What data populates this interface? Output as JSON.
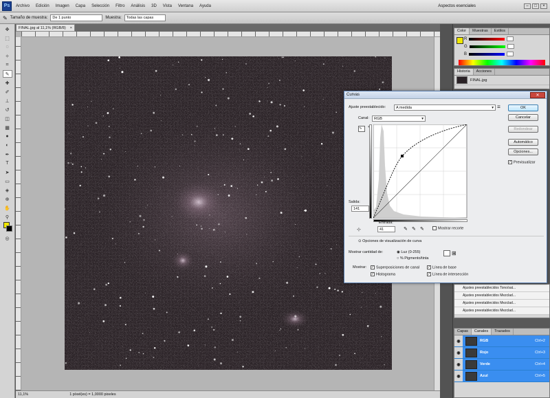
{
  "menubar": {
    "logo": "Ps",
    "items": [
      "Archivo",
      "Edición",
      "Imagen",
      "Capa",
      "Selección",
      "Filtro",
      "Análisis",
      "3D",
      "Vista",
      "Ventana",
      "Ayuda"
    ],
    "workspace": "Aspectos esenciales"
  },
  "options": {
    "sample_size_label": "Tamaño de muestra:",
    "sample_size_value": "De 1 punto",
    "sample_label": "Muestra:",
    "sample_value": "Todas las capas"
  },
  "document": {
    "tab_title": "FINAL.jpg al 11,1% (RGB/8)",
    "zoom": "11,1%",
    "status": "1 píxel(es) = 1,0000 pixeles"
  },
  "panels": {
    "color_tabs": [
      "Color",
      "Muestras",
      "Estilos"
    ],
    "rgb_labels": [
      "R",
      "G",
      "B"
    ],
    "history_tabs": [
      "Historia",
      "Acciones"
    ],
    "history_item": "FINAL.jpg",
    "actions": [
      "Ajustes preestablecidos Tono/sat...",
      "Ajustes preestablecidos Mezclad...",
      "Ajustes preestablecidos Mezclad...",
      "Ajustes preestablecidos Mezclad..."
    ],
    "layer_tabs": [
      "Capas",
      "Canales",
      "Trazados"
    ],
    "channels": [
      {
        "name": "RGB",
        "shortcut": "Ctrl+2"
      },
      {
        "name": "Rojo",
        "shortcut": "Ctrl+3"
      },
      {
        "name": "Verde",
        "shortcut": "Ctrl+4"
      },
      {
        "name": "Azul",
        "shortcut": "Ctrl+5"
      }
    ]
  },
  "curves": {
    "title": "Curvas",
    "preset_label": "Ajuste preestablecido:",
    "preset_value": "A medida",
    "channel_label": "Canal:",
    "channel_value": "RGB",
    "output_label": "Salida:",
    "output_value": "141",
    "input_label": "Entrada:",
    "input_value": "41",
    "show_clipping": "Mostrar recorte",
    "curve_options": "Opciones de visualización de curva",
    "show_amount_label": "Mostrar cantidad de:",
    "light_option": "Luz (0-255)",
    "pigment_option": "% Pigmento/tinta",
    "show_label": "Mostrar:",
    "overlay": "Superposiciones de canal",
    "histogram": "Histograma",
    "baseline": "Línea de base",
    "intersection": "Línea de intersección",
    "buttons": {
      "ok": "OK",
      "cancel": "Cancelar",
      "smooth": "Redondear",
      "auto": "Automático",
      "options": "Opciones..."
    },
    "preview": "Previsualizar"
  }
}
